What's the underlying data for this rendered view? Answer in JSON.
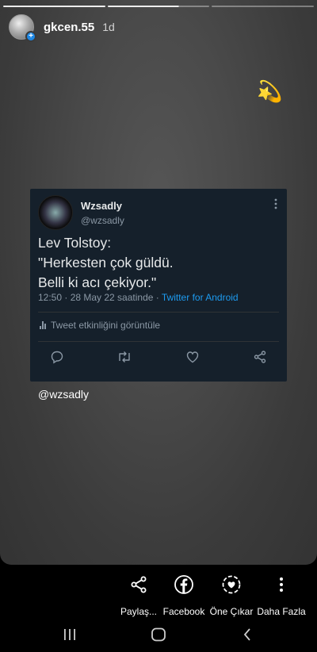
{
  "story": {
    "username": "gkcen.55",
    "time": "1d",
    "sticker": "💫",
    "mention": "@wzsadly",
    "progress_segments": 3,
    "active_segment_fraction": 0.7
  },
  "tweet": {
    "display_name": "Wzsadly",
    "handle": "@wzsadly",
    "lines": [
      "Lev Tolstoy:",
      "\"Herkesten çok güldü.",
      "Belli ki acı çekiyor.\""
    ],
    "meta": "12:50 · 28 May 22 saatinde · ",
    "source": "Twitter for Android",
    "activity_label": "Tweet etkinliğini görüntüle"
  },
  "share_bar": {
    "items": [
      {
        "label": "Paylaş...",
        "icon": "share-icon"
      },
      {
        "label": "Facebook",
        "icon": "facebook-icon"
      },
      {
        "label": "Öne Çıkar",
        "icon": "highlight-heart-icon"
      },
      {
        "label": "Daha Fazla",
        "icon": "more-vertical-icon"
      }
    ]
  },
  "nav_bar": {
    "items": [
      {
        "icon": "recent-apps-icon"
      },
      {
        "icon": "home-icon"
      },
      {
        "icon": "back-icon"
      }
    ]
  },
  "colors": {
    "tweet_bg": "#15202b",
    "link_blue": "#1d9bf0",
    "badge_blue": "#1e88e5"
  }
}
